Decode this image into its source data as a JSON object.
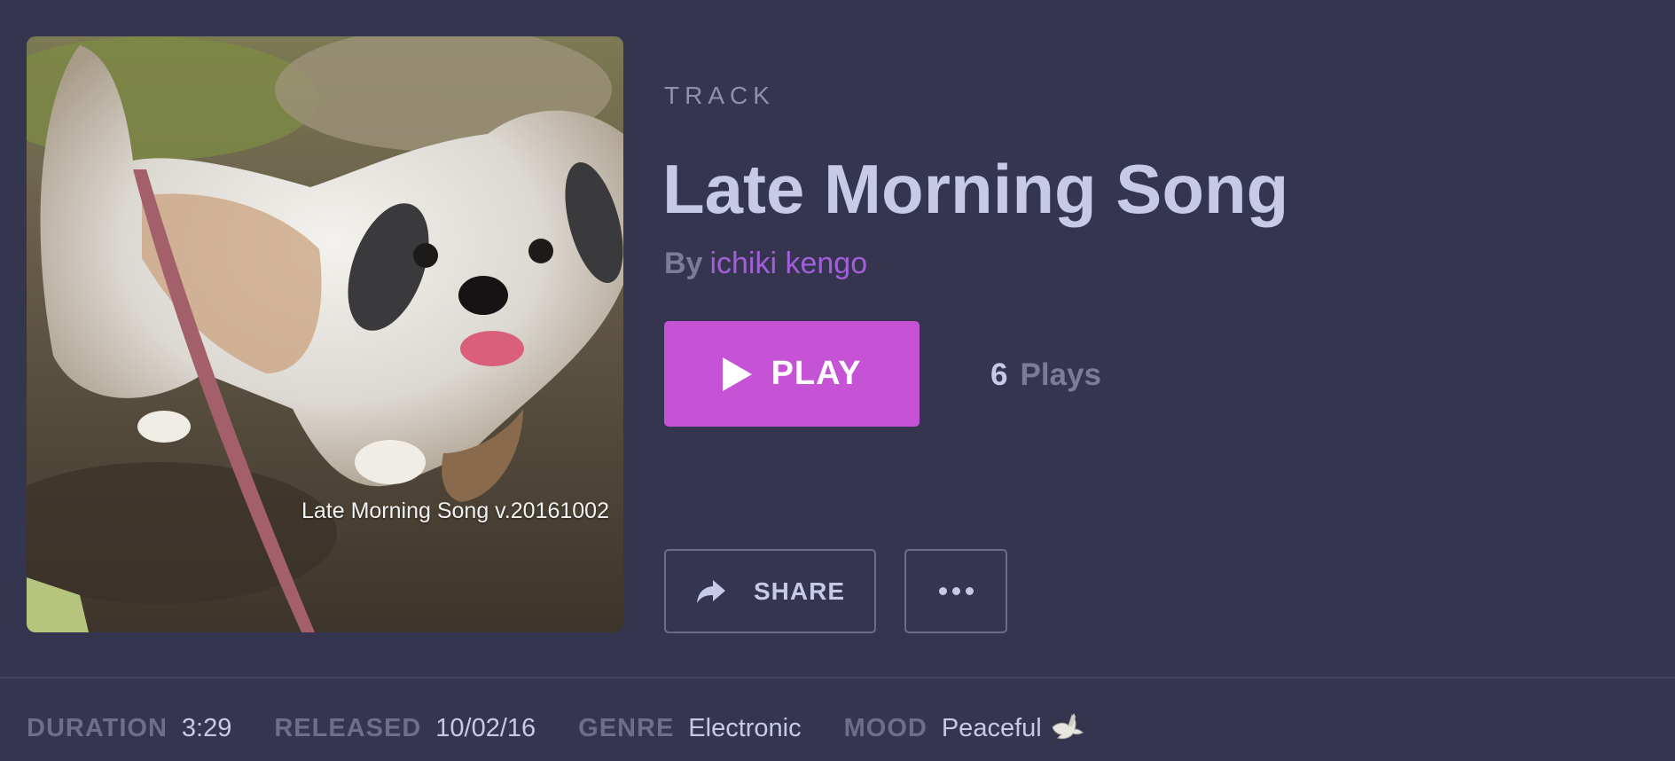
{
  "cover": {
    "caption": "Late Morning Song v.20161002"
  },
  "track": {
    "label": "TRACK",
    "title": "Late Morning Song",
    "by_prefix": "By",
    "artist": "ichiki kengo"
  },
  "actions": {
    "play_label": "PLAY",
    "share_label": "SHARE",
    "more_icon": "more-icon",
    "share_icon": "share-icon",
    "play_icon": "play-icon"
  },
  "stats": {
    "plays_count": "6",
    "plays_label": "Plays"
  },
  "meta": {
    "duration_label": "DURATION",
    "duration_value": "3:29",
    "released_label": "RELEASED",
    "released_value": "10/02/16",
    "genre_label": "GENRE",
    "genre_value": "Electronic",
    "mood_label": "MOOD",
    "mood_value": "Peaceful",
    "mood_icon": "dove-icon"
  },
  "colors": {
    "background": "#35354f",
    "accent": "#c652d6",
    "artist_link": "#a35fd9",
    "primary_text": "#c7cae6",
    "muted_text": "#7b7d98"
  }
}
